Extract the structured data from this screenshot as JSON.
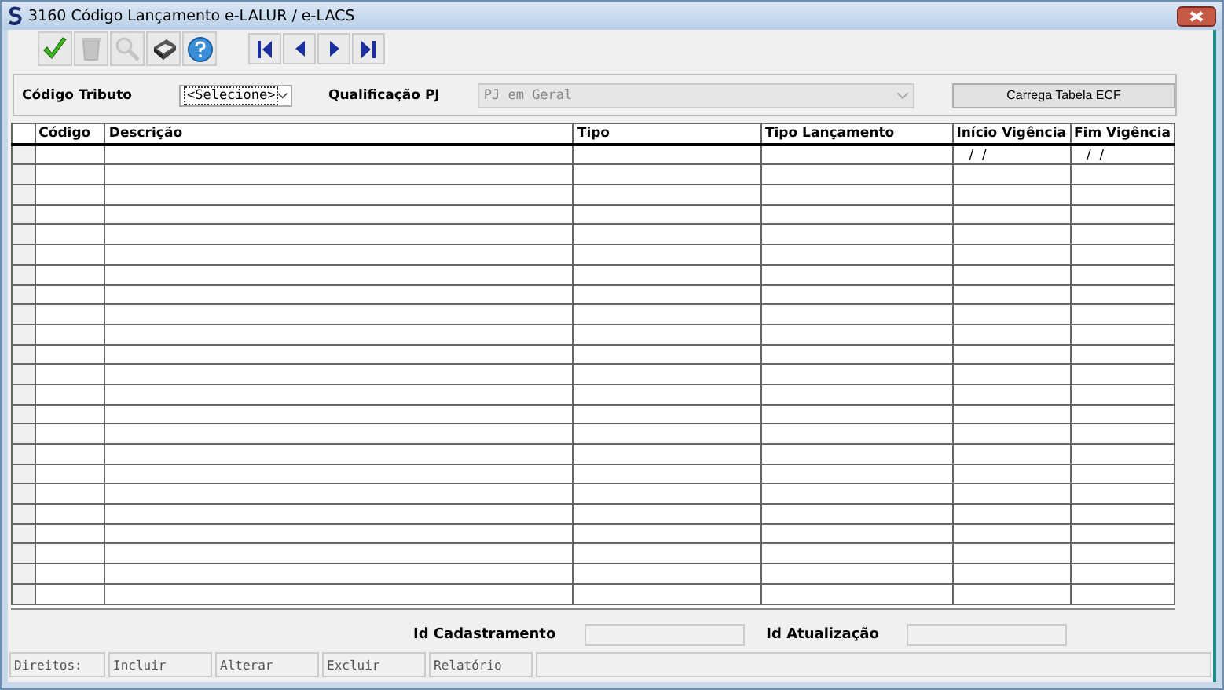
{
  "window": {
    "title": "3160 Código Lançamento e-LALUR / e-LACS"
  },
  "toolbar": [
    {
      "kind": "confirm",
      "disabled": false
    },
    {
      "kind": "delete",
      "disabled": true
    },
    {
      "kind": "search",
      "disabled": true
    },
    {
      "kind": "print",
      "disabled": false
    },
    {
      "kind": "help",
      "disabled": false
    }
  ],
  "navigation": [
    {
      "kind": "first"
    },
    {
      "kind": "prev"
    },
    {
      "kind": "next"
    },
    {
      "kind": "last"
    }
  ],
  "filters": {
    "codigo_tributo": {
      "label": "Código Tributo",
      "value": "<Selecione>"
    },
    "qualificacao_pj": {
      "label": "Qualificação PJ",
      "value": "PJ em Geral",
      "disabled": true
    },
    "load_button": "Carrega Tabela ECF"
  },
  "table": {
    "columns": [
      "Código",
      "Descrição",
      "Tipo",
      "Tipo Lançamento",
      "Início Vigência",
      "Fim Vigência"
    ],
    "rows": [
      {
        "cells": [
          "",
          "",
          "",
          "",
          "/  /",
          "/  /"
        ]
      }
    ]
  },
  "ids": [
    {
      "label": "Id Cadastramento"
    },
    {
      "label": "Id Atualização"
    }
  ],
  "status_bar": [
    "Direitos:",
    "Incluir",
    "Alterar",
    "Excluir",
    "Relatório"
  ]
}
